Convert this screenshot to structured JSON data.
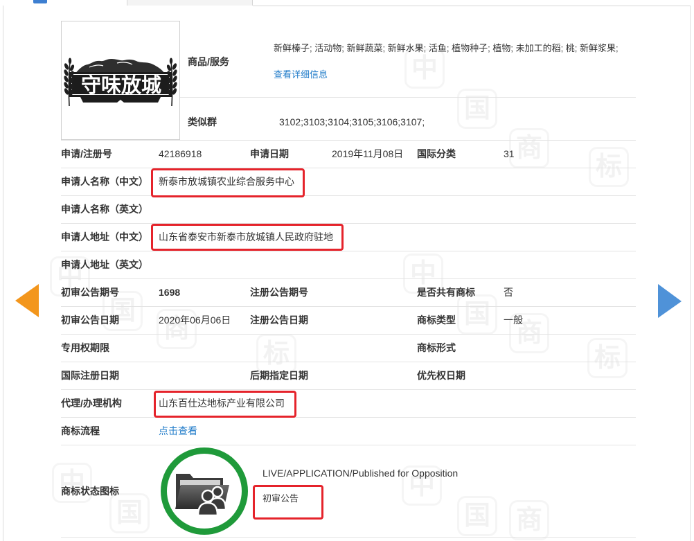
{
  "tabs": {
    "active_icon": "tab-icon"
  },
  "navigation": {
    "prev_icon": "prev-arrow-icon",
    "next_icon": "next-arrow-icon"
  },
  "trademark": {
    "logo_text": "守味放城",
    "goods_label": "商品/服务",
    "goods_value": "新鲜榛子; 活动物; 新鲜蔬菜; 新鲜水果; 活鱼; 植物种子; 植物; 未加工的稻; 桃; 新鲜浆果;",
    "goods_link": "查看详细信息",
    "similar_group_label": "类似群",
    "similar_group_value": "3102;3103;3104;3105;3106;3107;"
  },
  "details": {
    "registration_number_label": "申请/注册号",
    "registration_number": "42186918",
    "application_date_label": "申请日期",
    "application_date": "2019年11月08日",
    "international_class_label": "国际分类",
    "international_class": "31",
    "applicant_name_cn_label": "申请人名称（中文）",
    "applicant_name_cn": "新泰市放城镇农业综合服务中心",
    "applicant_name_en_label": "申请人名称（英文）",
    "applicant_address_cn_label": "申请人地址（中文）",
    "applicant_address_cn": "山东省泰安市新泰市放城镇人民政府驻地",
    "applicant_address_en_label": "申请人地址（英文）",
    "preliminary_issue_label": "初审公告期号",
    "preliminary_issue": "1698",
    "registration_issue_label": "注册公告期号",
    "shared_mark_label": "是否共有商标",
    "shared_mark": "否",
    "preliminary_date_label": "初审公告日期",
    "preliminary_date": "2020年06月06日",
    "registration_date_label": "注册公告日期",
    "mark_type_label": "商标类型",
    "mark_type": "一般",
    "exclusive_period_label": "专用权期限",
    "mark_form_label": "商标形式",
    "intl_registration_date_label": "国际注册日期",
    "subsequent_designation_label": "后期指定日期",
    "priority_date_label": "优先权日期",
    "agent_label": "代理/办理机构",
    "agent": "山东百仕达地标产业有限公司",
    "process_label": "商标流程",
    "process_link": "点击查看"
  },
  "status": {
    "label": "商标状态图标",
    "icon": "folder-users-icon",
    "text_en": "LIVE/APPLICATION/Published for Opposition",
    "text_cn": "初审公告"
  },
  "watermark": {
    "chars": [
      "中",
      "国",
      "商",
      "标"
    ]
  },
  "colors": {
    "link": "#1f7bc9",
    "highlight_box": "#e5232b",
    "status_ring": "#1f9a3a",
    "prev_arrow": "#f3961c",
    "next_arrow": "#4f92d8",
    "tab_icon": "#3d7fd1"
  }
}
